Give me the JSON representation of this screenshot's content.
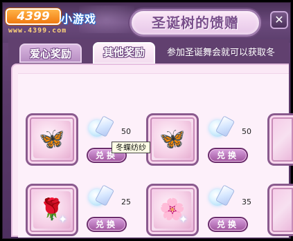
{
  "header": {
    "logo_number": "4399",
    "logo_text": "小游戏",
    "logo_url": "www.4399.com",
    "title": "圣诞树的馈赠",
    "close_symbol": "✕"
  },
  "tabs": [
    {
      "label": "爱心奖励",
      "active": false
    },
    {
      "label": "其他奖励",
      "active": true
    }
  ],
  "notice": "参加圣诞舞会就可以获取冬",
  "items": [
    {
      "name": "butterfly-gauze-item",
      "glyph": "🦋",
      "cost": "50",
      "button": "兑换"
    },
    {
      "name": "butterfly-gauze-item-2",
      "glyph": "🦋",
      "cost": "50",
      "button": "兑换"
    },
    {
      "name": "rose-item",
      "glyph": "🌹",
      "cost": "25",
      "button": "兑换"
    },
    {
      "name": "white-rose-item",
      "glyph": "🌸",
      "cost": "35",
      "button": "兑换"
    }
  ],
  "tooltip": "冬蝶纺纱",
  "colors": {
    "frame": "#5a3a6a",
    "panel": "#fbe8f6",
    "button": "#a0559e"
  }
}
